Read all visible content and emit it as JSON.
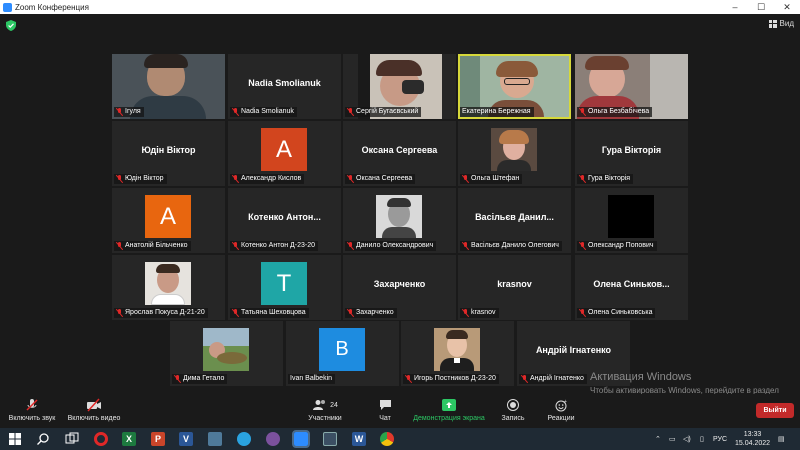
{
  "window": {
    "title": "Zoom Конференция"
  },
  "view_button": {
    "label": "Вид"
  },
  "participants": [
    {
      "name": "Ігуля",
      "display": ""
    },
    {
      "name": "Nadia Smolianuk",
      "display": "Nadia Smolianuk"
    },
    {
      "name": "Сергій Бугаєвський",
      "display": ""
    },
    {
      "name": "Екатерина Бережная",
      "display": ""
    },
    {
      "name": "Ольга Безбабічева",
      "display": ""
    },
    {
      "name": "Юдін Віктор",
      "display": "Юдін Віктор"
    },
    {
      "name": "Александр Кислов",
      "display": "",
      "avatar_letter": "A"
    },
    {
      "name": "Оксана Сергеева",
      "display": "Оксана Сергеева"
    },
    {
      "name": "Ольга Штефан",
      "display": ""
    },
    {
      "name": "Гура Вікторія",
      "display": "Гура Вікторія"
    },
    {
      "name": "Анатолій Більченко",
      "display": "",
      "avatar_letter": "A"
    },
    {
      "name": "Котенко Антон Д-23-20",
      "display": "Котенко Антон..."
    },
    {
      "name": "Данило Олександрович",
      "display": ""
    },
    {
      "name": "Васільєв Данило Олегович",
      "display": "Васільєв Данил..."
    },
    {
      "name": "Олександр Попович",
      "display": ""
    },
    {
      "name": "Ярослав Покуса Д-21-20",
      "display": ""
    },
    {
      "name": "Татьяна Шеховцова",
      "display": "",
      "avatar_letter": "T"
    },
    {
      "name": "Захарченко",
      "display": "Захарченко"
    },
    {
      "name": "krasnov",
      "display": "krasnov"
    },
    {
      "name": "Олена Синьковська",
      "display": "Олена Синьков..."
    },
    {
      "name": "Дима Гетало",
      "display": ""
    },
    {
      "name": "Ivan Balbekin",
      "display": "",
      "avatar_letter": "B"
    },
    {
      "name": "Игорь Постников Д-23-20",
      "display": ""
    },
    {
      "name": "Андрій Ігнатенко",
      "display": "Андрій Ігнатенко"
    }
  ],
  "toolbar": {
    "audio_label": "Включить звук",
    "video_label": "Включить видео",
    "participants_label": "Участники",
    "participants_count": "24",
    "chat_label": "Чат",
    "share_label": "Демонстрация экрана",
    "record_label": "Запись",
    "reactions_label": "Реакции",
    "exit_label": "Выйти"
  },
  "watermark": {
    "line1": "Активация Windows",
    "line2": "Чтобы активировать Windows, перейдите в раздел \"Параметры\"."
  },
  "taskbar": {
    "language": "РУС",
    "time": "13:33",
    "date": "15.04.2022"
  },
  "colors": {
    "share_green": "#2cc764",
    "active_speaker": "#d6d83a",
    "exit_red": "#c22a2a",
    "avatar_orange": "#e8660f",
    "avatar_red": "#d2451e",
    "avatar_teal": "#1fa6a6",
    "avatar_blue": "#1e8ce0"
  }
}
